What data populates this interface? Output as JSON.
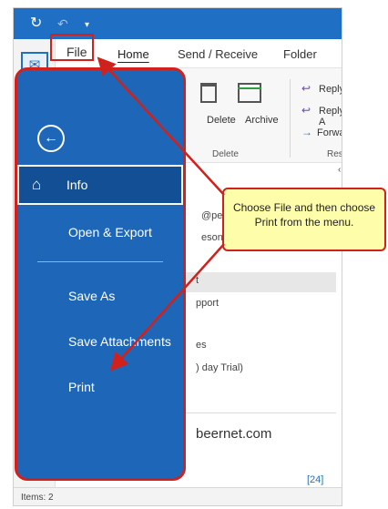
{
  "quick_access": {
    "sync_icon": "sync-icon",
    "undo_icon": "undo-icon",
    "customize_icon": "dropdown-icon"
  },
  "ribbon": {
    "tabs": [
      "File",
      "Home",
      "Send / Receive",
      "Folder"
    ],
    "delete_label": "Delete",
    "archive_label": "Archive",
    "delete_group": "Delete",
    "reply_label": "Reply",
    "reply_all_label": "Reply A",
    "forward_label": "Forwarc",
    "respond_group": "Respo"
  },
  "message_list": {
    "fragments": [
      "@peer",
      "eson@",
      "t",
      "pport",
      "es",
      ") day Trial)"
    ],
    "email": "beernet.com",
    "count": "[24]"
  },
  "backstage": {
    "items": [
      "Info",
      "Open & Export",
      "Save As",
      "Save Attachments",
      "Print"
    ],
    "selected": "Info"
  },
  "callout": {
    "text": "Choose File and then choose Print from the menu."
  },
  "status": {
    "items": "Items: 2"
  },
  "colors": {
    "accent": "#1f6fc4",
    "backstage": "#1e67b8",
    "selected": "#124f95",
    "annotation": "#d0211c",
    "callout_fill": "#fefeaa"
  }
}
